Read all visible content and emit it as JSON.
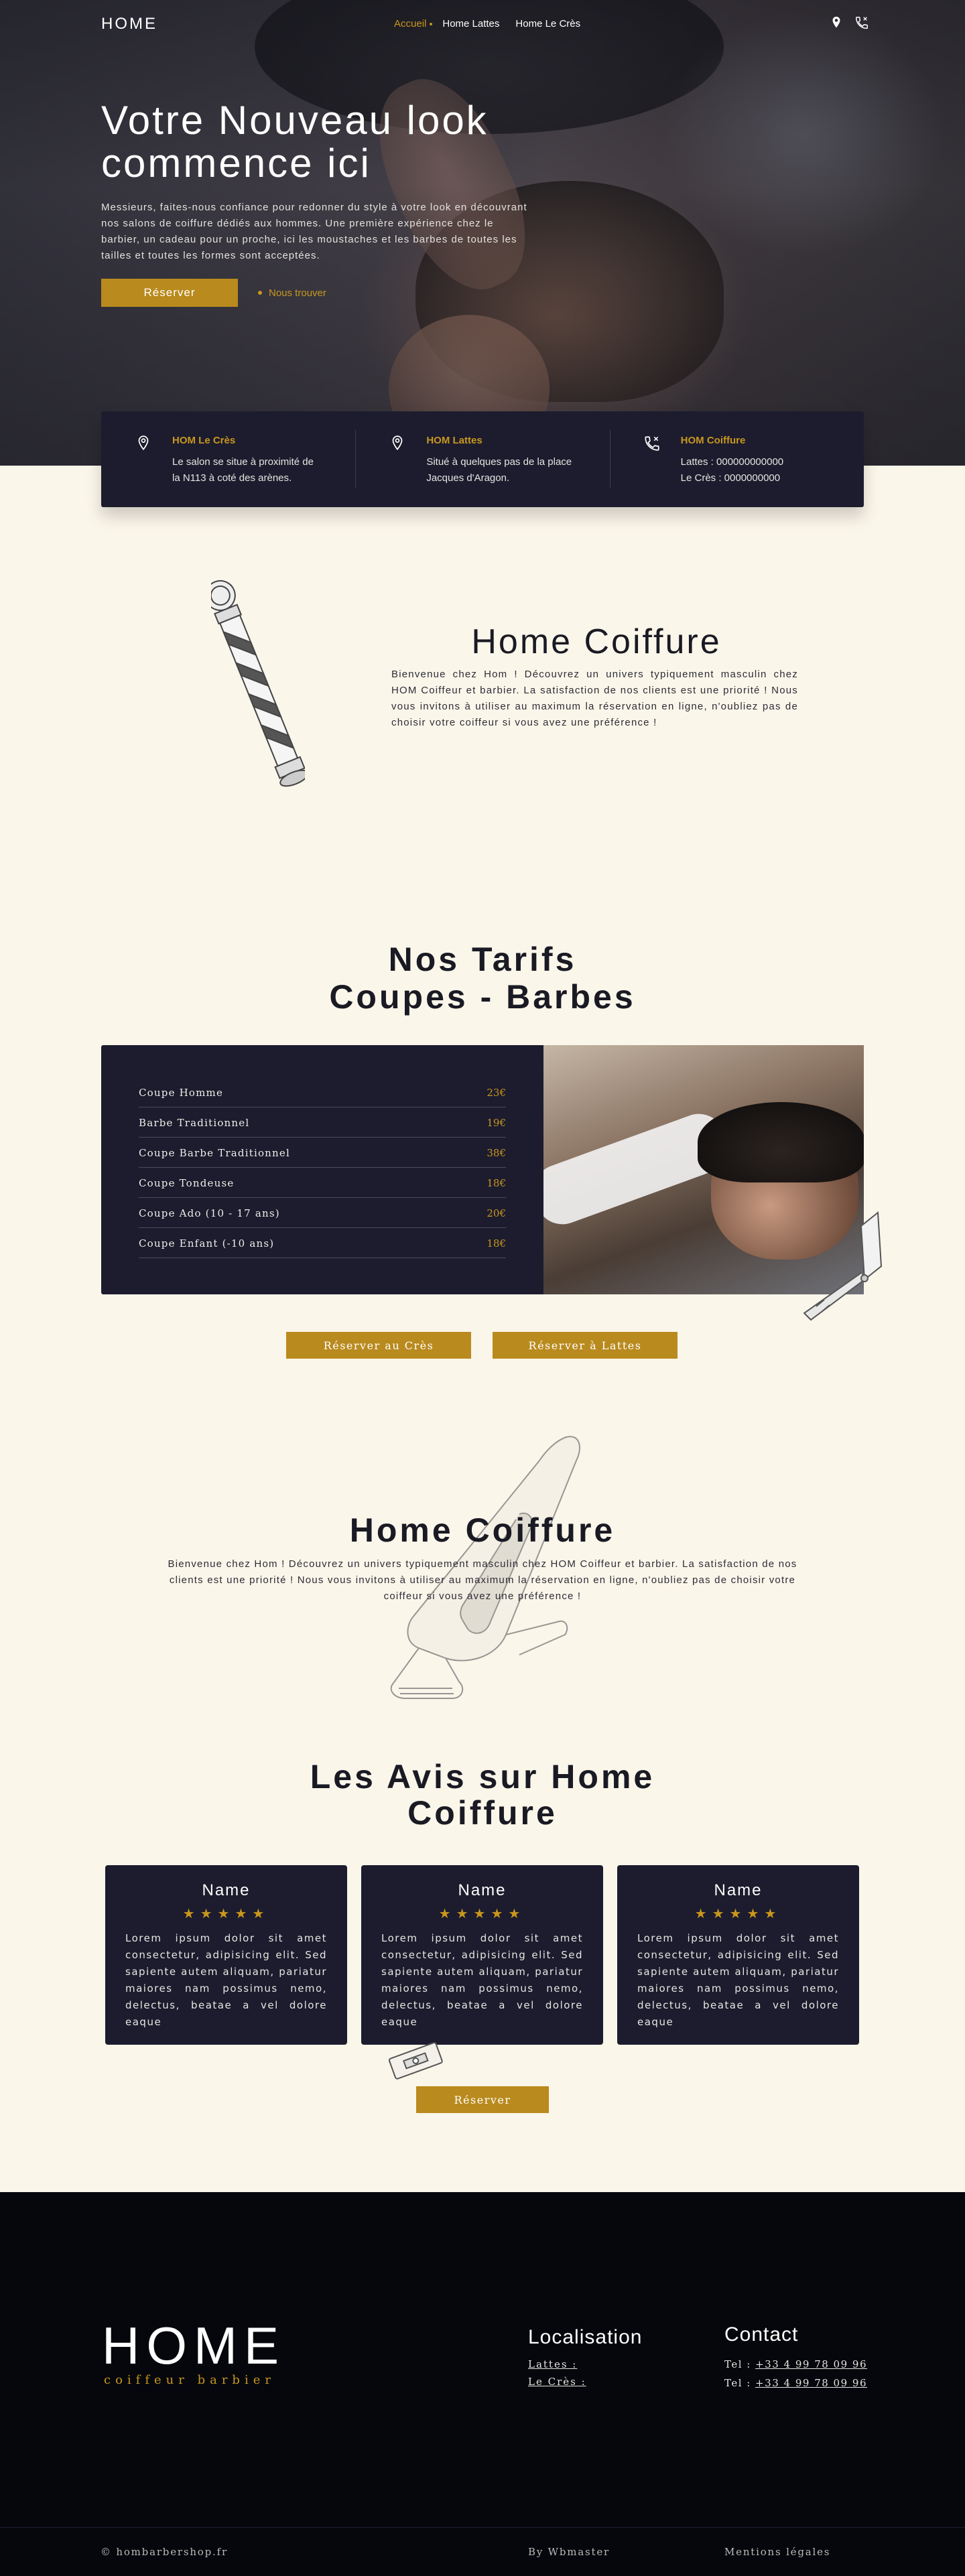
{
  "nav": {
    "logo": "HOME",
    "items": [
      {
        "label": "Accueil",
        "active": true
      },
      {
        "label": "Home Lattes",
        "active": false
      },
      {
        "label": "Home Le Crès",
        "active": false
      }
    ],
    "icons": [
      "location-pin-icon",
      "phone-icon"
    ]
  },
  "hero": {
    "title_line1": "Votre Nouveau look",
    "title_line2": "commence ici",
    "text": "Messieurs, faites-nous confiance pour redonner du style à votre look en découvrant nos salons de coiffure dédiés aux hommes. Une première expérience chez le barbier, un cadeau pour un proche, ici les moustaches et les barbes de toutes les tailles et toutes les formes sont acceptées.",
    "cta": "Réserver",
    "find": "Nous trouver"
  },
  "info": [
    {
      "icon": "location-pin-icon",
      "title": "HOM Le Crès",
      "lines": [
        "Le salon se situe à proximité de",
        "la N113 à coté des arènes."
      ]
    },
    {
      "icon": "location-pin-icon",
      "title": "HOM Lattes",
      "lines": [
        "Situé à quelques pas de la place",
        "Jacques d'Aragon."
      ]
    },
    {
      "icon": "phone-icon",
      "title": "HOM Coiffure",
      "lines": [
        "Lattes : 000000000000",
        "Le Crès : 0000000000"
      ]
    }
  ],
  "about1": {
    "title": "Home Coiffure",
    "text": "Bienvenue chez Hom ! Découvrez un univers typiquement masculin chez HOM Coiffeur et barbier. La satisfaction de nos clients est une priorité ! Nous vous invitons à utiliser au maximum la réservation en ligne, n'oubliez pas de choisir votre coiffeur si vous avez une préférence !"
  },
  "tarifs": {
    "title_line1": "Nos Tarifs",
    "title_line2": "Coupes - Barbes",
    "items": [
      {
        "name": "Coupe Homme",
        "price": "23€"
      },
      {
        "name": "Barbe Traditionnel",
        "price": "19€"
      },
      {
        "name": "Coupe Barbe Traditionnel",
        "price": "38€"
      },
      {
        "name": "Coupe Tondeuse",
        "price": "18€"
      },
      {
        "name": "Coupe Ado (10 - 17 ans)",
        "price": "20€"
      },
      {
        "name": "Coupe Enfant (-10 ans)",
        "price": "18€"
      }
    ],
    "btn_cres": "Réserver au Crès",
    "btn_lattes": "Réserver à Lattes"
  },
  "about2": {
    "title": "Home Coiffure",
    "text": "Bienvenue chez Hom ! Découvrez un univers typiquement masculin chez HOM Coiffeur et barbier. La satisfaction de nos clients est une priorité ! Nous vous invitons à utiliser au maximum la réservation en ligne, n'oubliez pas de choisir votre coiffeur si vous avez une préférence !"
  },
  "avis": {
    "title_line1": "Les Avis sur Home",
    "title_line2": "Coiffure",
    "reviews": [
      {
        "name": "Name",
        "stars": "★★★★★",
        "text": "Lorem ipsum dolor sit amet consectetur, adipisicing elit. Sed sapiente autem aliquam, pariatur maiores nam possimus nemo, delectus, beatae a vel dolore eaque"
      },
      {
        "name": "Name",
        "stars": "★★★★★",
        "text": "Lorem ipsum dolor sit amet consectetur, adipisicing elit. Sed sapiente autem aliquam, pariatur maiores nam possimus nemo, delectus, beatae a vel dolore eaque"
      },
      {
        "name": "Name",
        "stars": "★★★★★",
        "text": "Lorem ipsum dolor sit amet consectetur, adipisicing elit. Sed sapiente autem aliquam, pariatur maiores nam possimus nemo, delectus, beatae a vel dolore eaque"
      }
    ],
    "cta": "Réserver"
  },
  "footer": {
    "logo": "HOME",
    "subtitle": "coiffeur barbier",
    "localisation_title": "Localisation",
    "loc_lattes": "Lattes :",
    "loc_cres": "Le Crès :",
    "contact_title": "Contact",
    "tel_label": "Tel : ",
    "tel1": "+33 4 99 78 09 96",
    "tel2": "+33 4 99 78 09 96",
    "copyright": "© hombarbershop.fr",
    "by": "By Wbmaster",
    "legal": "Mentions légales"
  },
  "colors": {
    "gold": "#b98a1d",
    "navy": "#1c1c2e",
    "cream": "#fbf6ea",
    "footer": "#06070d"
  }
}
